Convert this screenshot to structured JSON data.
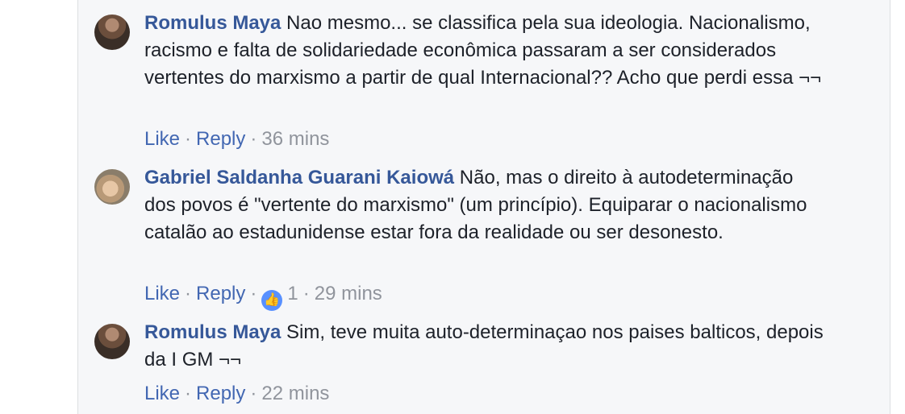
{
  "comments": [
    {
      "author": "Romulus Maya",
      "text": "Nao mesmo... se classifica pela sua ideologia. Nacionalismo, racismo e falta de solidariedade econômica passaram a ser considerados vertentes do marxismo a partir de qual Internacional?? Acho que perdi essa ¬¬",
      "like_label": "Like",
      "reply_label": "Reply",
      "time": "36 mins",
      "avatar_icon": "user-avatar-photo"
    },
    {
      "author": "Gabriel Saldanha Guarani Kaiowá",
      "text": "Não, mas o direito à autodeterminação dos povos é \"vertente do marxismo\" (um princípio). Equiparar o nacionalismo catalão ao estadunidense estar fora da realidade ou ser desonesto.",
      "like_label": "Like",
      "reply_label": "Reply",
      "reaction_count": "1",
      "reaction_icon": "thumbs-up-icon",
      "time": "29 mins",
      "avatar_icon": "user-avatar-photo"
    },
    {
      "author": "Romulus Maya",
      "text": "Sim, teve muita auto-determinaçao nos paises balticos, depois da I GM ¬¬",
      "like_label": "Like",
      "reply_label": "Reply",
      "time": "22 mins",
      "avatar_icon": "user-avatar-photo"
    }
  ],
  "colors": {
    "author": "#365899",
    "link": "#4267b2",
    "meta": "#90949c",
    "text": "#1d2129",
    "panel_bg": "#f6f7f9",
    "reaction_badge": "#5890ff"
  }
}
